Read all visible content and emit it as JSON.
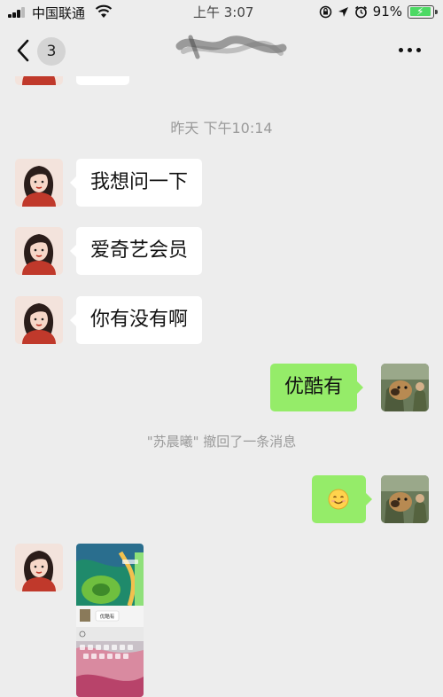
{
  "status_bar": {
    "carrier": "中国联通",
    "time": "上午 3:07",
    "battery_percent": "91%",
    "battery_level": 0.91,
    "icons": [
      "signal-icon",
      "wifi-icon",
      "orientation-lock-icon",
      "location-icon",
      "alarm-icon",
      "battery-icon"
    ]
  },
  "nav": {
    "unread_count": "3",
    "icons": [
      "back-chevron-icon",
      "more-icon"
    ]
  },
  "chat": {
    "timestamp": "昨天 下午10:14",
    "messages": [
      {
        "side": "in",
        "text": "我想问一下"
      },
      {
        "side": "in",
        "text": "爱奇艺会员"
      },
      {
        "side": "in",
        "text": "你有没有啊"
      },
      {
        "side": "out",
        "text": "优酷有"
      }
    ],
    "recall_notice": "\"苏晨曦\" 撤回了一条消息",
    "emoji_message": {
      "side": "out",
      "emoji": "smile-emoji"
    },
    "image_message": {
      "side": "in",
      "inner_label": "优酷有"
    }
  },
  "colors": {
    "background": "#ededed",
    "incoming_bubble": "#ffffff",
    "outgoing_bubble": "#95ec69",
    "meta_text": "#9a9a9a"
  }
}
